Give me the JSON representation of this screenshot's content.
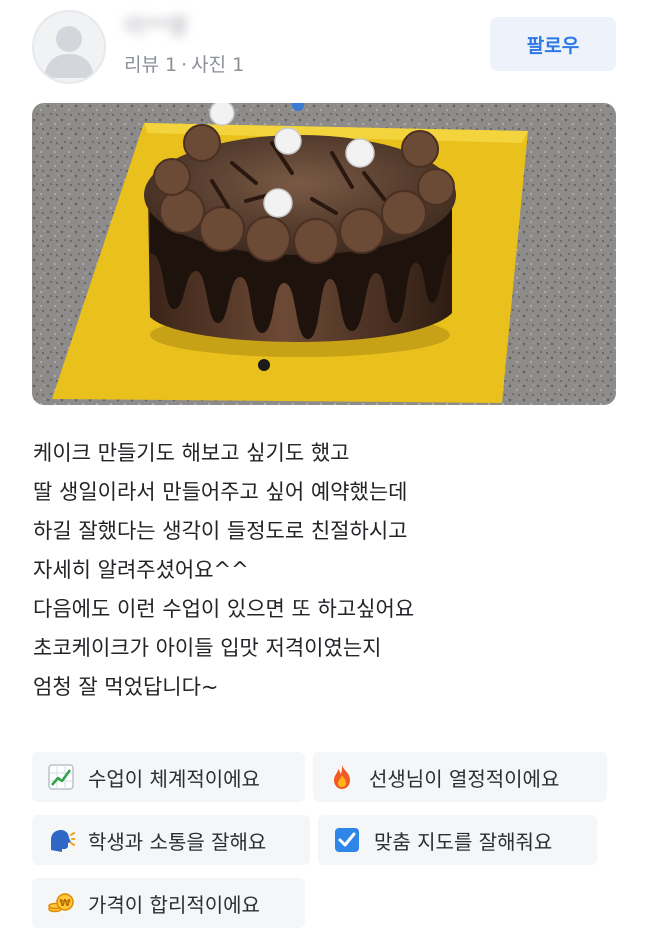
{
  "user": {
    "name": "이**영",
    "reviews_label": "리뷰 1",
    "separator": "·",
    "photos_label": "사진 1",
    "follow_label": "팔로우"
  },
  "photo": {
    "subject": "chocolate drip cake on yellow board"
  },
  "review": {
    "lines": [
      "케이크 만들기도 해보고 싶기도 했고",
      "딸 생일이라서 만들어주고 싶어 예약했는데",
      "하길 잘했다는 생각이 들정도로 친절하시고",
      "자세히 알려주셨어요^^",
      "다음에도 이런 수업이 있으면 또 하고싶어요",
      "초코케이크가 아이들 입맛 저격이였는지",
      "엄청 잘 먹었답니다~"
    ]
  },
  "tags": [
    {
      "icon": "chart-increasing-icon",
      "label": "수업이 체계적이에요"
    },
    {
      "icon": "fire-icon",
      "label": "선생님이 열정적이에요"
    },
    {
      "icon": "speaking-head-icon",
      "label": "학생과 소통을 잘해요"
    },
    {
      "icon": "check-box-icon",
      "label": "맞춤 지도를 잘해줘요"
    },
    {
      "icon": "coin-icon",
      "label": "가격이 합리적이에요"
    }
  ],
  "colors": {
    "accent": "#2e79e6",
    "tag_bg": "#f5f6f8",
    "follow_bg": "#eef3fb"
  }
}
